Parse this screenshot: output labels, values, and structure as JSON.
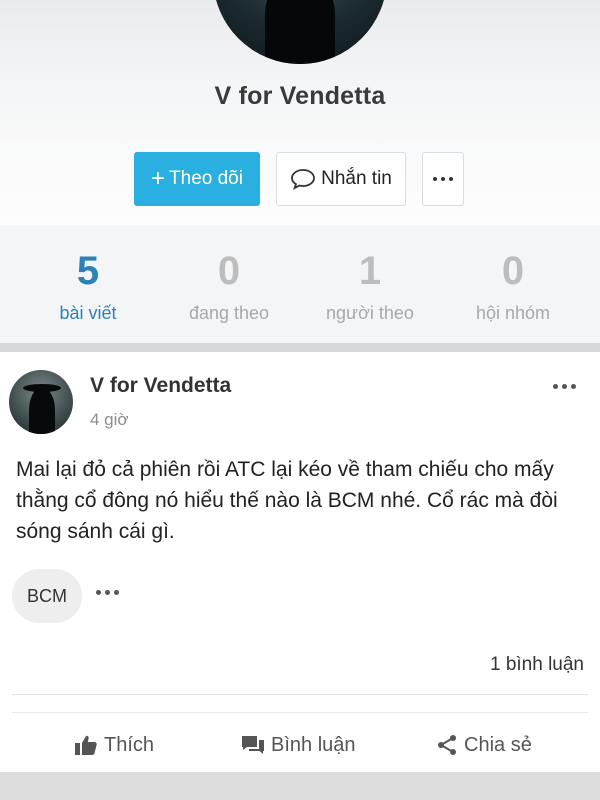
{
  "profile": {
    "name": "V for Vendetta",
    "follow_label": "Theo dõi",
    "follow_plus": "+",
    "message_label": "Nhắn tin"
  },
  "stats": [
    {
      "value": "5",
      "label": "bài viết"
    },
    {
      "value": "0",
      "label": "đang theo"
    },
    {
      "value": "1",
      "label": "người theo"
    },
    {
      "value": "0",
      "label": "hội nhóm"
    }
  ],
  "post": {
    "author": "V for Vendetta",
    "time": "4 giờ",
    "body": "Mai lại đỏ cả phiên rồi ATC lại kéo về tham chiếu cho mấy thằng cổ đông nó hiểu thế nào là BCM nhé. Cổ rác mà đòi sóng sánh cái gì.",
    "tag": "BCM",
    "comment_count": "1 bình luận",
    "actions": {
      "like": "Thích",
      "comment": "Bình luận",
      "share": "Chia sẻ"
    }
  },
  "colors": {
    "accent": "#29b0e1",
    "active_stat": "#2b82b8",
    "muted": "#bdbdbd"
  },
  "icons": [
    "chat-bubble-icon",
    "more-dots-icon",
    "thumbs-up-icon",
    "comment-icon",
    "share-icon"
  ]
}
